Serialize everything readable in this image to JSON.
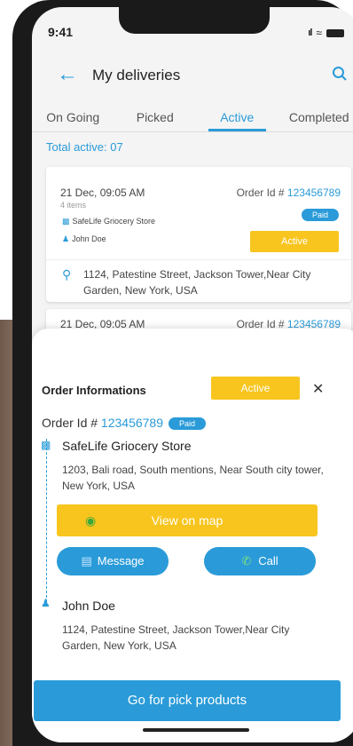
{
  "status_bar": {
    "time": "9:41",
    "signal": "ıl",
    "wifi": "≈"
  },
  "header": {
    "title": "My deliveries",
    "back_icon": "arrow-left-icon",
    "search_icon": "search-icon"
  },
  "tabs": [
    {
      "label": "On Going"
    },
    {
      "label": "Picked"
    },
    {
      "label": "Active"
    },
    {
      "label": "Completed"
    }
  ],
  "selected_tab": "Active",
  "summary": {
    "total_label": "Total active: 07"
  },
  "orders": [
    {
      "date": "21 Dec, 09:05 AM",
      "items": "4 items",
      "order_prefix": "Order Id # ",
      "order_id": "123456789",
      "payment_status": "Paid",
      "store": "SafeLife Griocery Store",
      "customer": "John Doe",
      "status": "Active",
      "address": "1124, Patestine Street, Jackson Tower,Near City Garden, New York, USA"
    },
    {
      "date": "21 Dec, 09:05 AM",
      "order_prefix": "Order Id # ",
      "order_id": "123456789"
    }
  ],
  "sheet": {
    "title": "Order Informations",
    "status": "Active",
    "close_symbol": "✕",
    "order_prefix": "Order Id # ",
    "order_id": "123456789",
    "payment_status": "Paid",
    "store_name": "SafeLife Griocery Store",
    "store_address": "1203, Bali road, South mentions, Near South city tower, New York, USA",
    "map_button": "View on map",
    "message_button": "Message",
    "call_button": "Call",
    "customer_name": "John Doe",
    "customer_address": "1124, Patestine Street, Jackson Tower,Near City Garden, New York, USA",
    "primary_button": "Go for pick products"
  },
  "colors": {
    "accent": "#2a9bd8",
    "warning": "#f7c51e",
    "success": "#3aa83a"
  }
}
